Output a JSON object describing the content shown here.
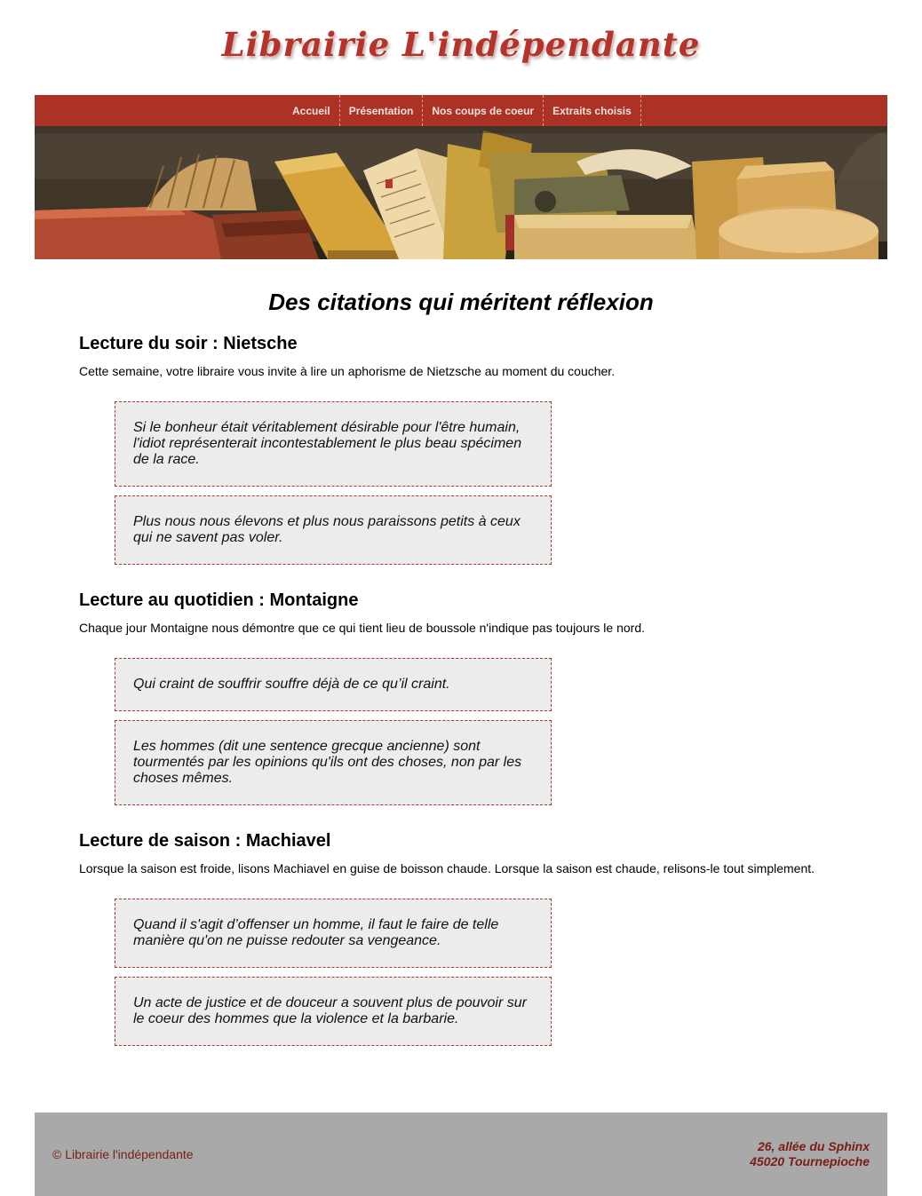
{
  "header": {
    "site_title": "Librairie L'indépendante"
  },
  "nav": {
    "items": [
      {
        "label": "Accueil"
      },
      {
        "label": "Présentation"
      },
      {
        "label": "Nos coups de coeur"
      },
      {
        "label": "Extraits choisis"
      }
    ]
  },
  "colors": {
    "accent": "#ad3226",
    "quote_background": "#ececec",
    "footer_background": "#a9a9a9",
    "footer_text": "#7a1d14"
  },
  "main": {
    "heading": "Des citations qui méritent réflexion",
    "sections": [
      {
        "title": "Lecture du soir : Nietsche",
        "intro": "Cette semaine, votre libraire vous invite à lire un aphorisme de Nietzsche au moment du coucher.",
        "quotes": [
          "Si le bonheur était véritablement désirable pour l'être humain, l'idiot représenterait incontestablement le plus beau spécimen de la race.",
          "Plus nous nous élevons et plus nous paraissons petits à ceux qui ne savent pas voler."
        ]
      },
      {
        "title": "Lecture au quotidien : Montaigne",
        "intro": "Chaque jour Montaigne nous démontre que ce qui tient lieu de boussole n'indique pas toujours le nord.",
        "quotes": [
          "Qui craint de souffrir souffre déjà de ce qu’il craint.",
          "Les hommes (dit une sentence grecque ancienne) sont tourmentés par les opinions qu'ils ont des choses, non par les choses mêmes."
        ]
      },
      {
        "title": "Lecture de saison : Machiavel",
        "intro": "Lorsque la saison est froide, lisons Machiavel en guise de boisson chaude. Lorsque la saison est chaude, relisons-le tout simplement.",
        "quotes": [
          "Quand il s'agit d’offenser un homme, il faut le faire de telle manière qu'on ne puisse redouter sa vengeance.",
          "Un acte de justice et de douceur a souvent plus de pouvoir sur le coeur des hommes que la violence et la barbarie."
        ]
      }
    ]
  },
  "footer": {
    "copyright": "© Librairie l'indépendante",
    "address_line1": "26, allée du Sphinx",
    "address_line2": "45020 Tournepioche"
  }
}
